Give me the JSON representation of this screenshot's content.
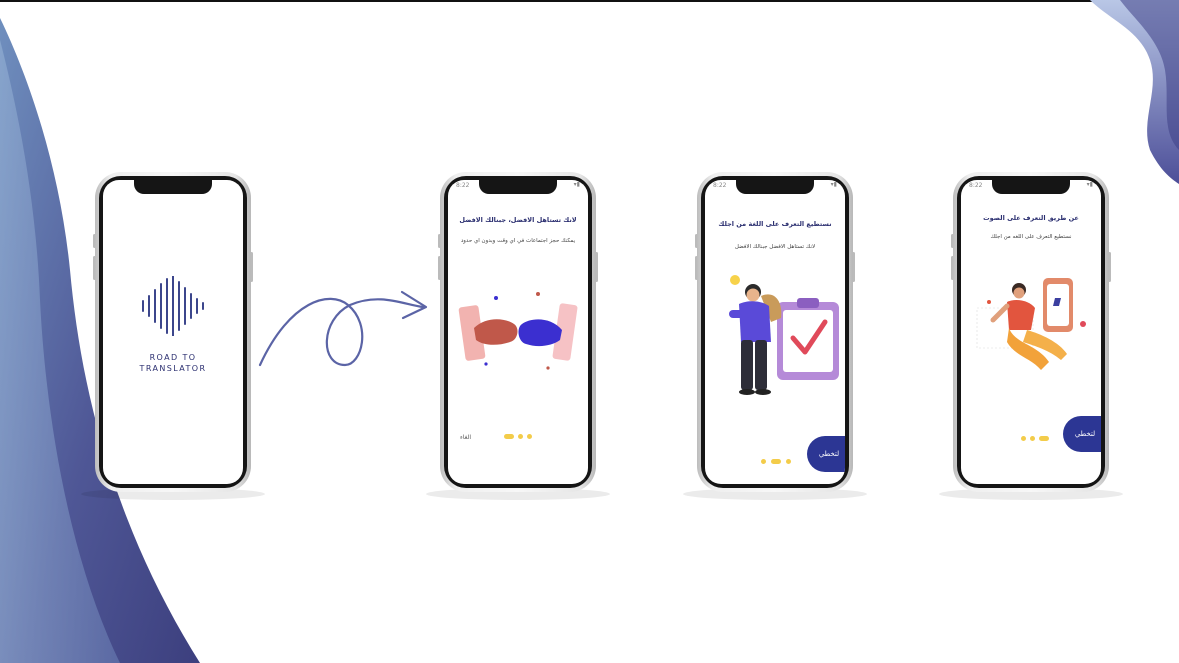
{
  "colors": {
    "brand_navy": "#2b2f70",
    "button_blue": "#2c3694",
    "dot_yellow": "#f3cc4a",
    "wave_left": "#4a4f8e",
    "wave_right": "#5a5fa8"
  },
  "phone1": {
    "logo_icon": "sound-wave-icon",
    "brand_line1": "ROAD TO",
    "brand_line2": "TRANSLATOR"
  },
  "phone2": {
    "status_time": "8:22",
    "title": "لانك تستاهل الافضل، جبنالك الافضل",
    "subtitle": "يمكنك حجز اجتماعات في اي وقت وبدون اي حدود",
    "skip_label": "الغاء",
    "illustration": "handshake-illustration"
  },
  "phone3": {
    "status_time": "8:22",
    "title": "نستطيع التعرف على اللغة من اجلك",
    "subtitle": "لانك تستاهل الافضل جبنالك الافضل",
    "next_label": "لتخطي",
    "illustration": "person-clipboard-illustration"
  },
  "phone4": {
    "status_time": "8:22",
    "title": "عن طريق التعرف على الصوت",
    "subtitle": "نستطيع التعرف على اللغه من اجلك",
    "next_label": "لتخطي",
    "illustration": "woman-phone-illustration"
  }
}
